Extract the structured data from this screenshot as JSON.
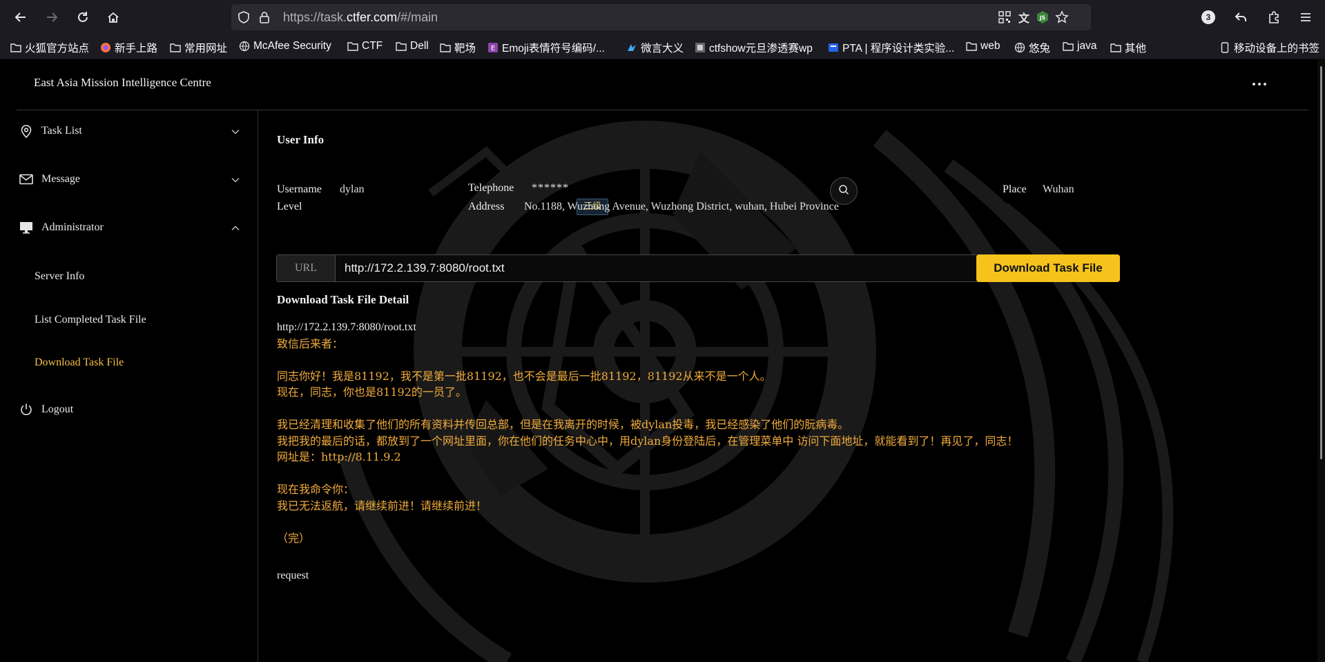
{
  "browser": {
    "url_prefix": "https://task.",
    "url_host": "ctfer.com",
    "url_rest": "/#/main",
    "notification_count": "3",
    "bookmarks": [
      {
        "icon": "folder-icon",
        "label": "火狐官方站点"
      },
      {
        "icon": "firefox-icon",
        "label": "新手上路"
      },
      {
        "icon": "folder-icon",
        "label": "常用网址"
      },
      {
        "icon": "globe-icon",
        "label": "McAfee Security"
      },
      {
        "icon": "folder-icon",
        "label": "CTF"
      },
      {
        "icon": "folder-icon",
        "label": "Dell"
      },
      {
        "icon": "folder-icon",
        "label": "靶场"
      },
      {
        "icon": "emoji-site-icon",
        "label": "Emoji表情符号编码/..."
      },
      {
        "icon": "weiyan-icon",
        "label": "微言大义"
      },
      {
        "icon": "ctfshow-icon",
        "label": "ctfshow元旦渗透赛wp"
      },
      {
        "icon": "pta-icon",
        "label": "PTA | 程序设计类实验..."
      },
      {
        "icon": "folder-icon",
        "label": "web"
      },
      {
        "icon": "globe-icon",
        "label": "悠兔"
      },
      {
        "icon": "folder-icon",
        "label": "java"
      },
      {
        "icon": "folder-icon",
        "label": "其他"
      },
      {
        "icon": "mobile-icon",
        "label": "移动设备上的书签"
      }
    ]
  },
  "app": {
    "title": "East Asia Mission Intelligence Centre"
  },
  "sidebar": {
    "items": [
      {
        "icon": "location-pin-icon",
        "label": "Task List",
        "expanded": false
      },
      {
        "icon": "mail-icon",
        "label": "Message",
        "expanded": false
      },
      {
        "icon": "monitor-icon",
        "label": "Administrator",
        "expanded": true
      }
    ],
    "sub_items": [
      {
        "label": "Server Info",
        "active": false
      },
      {
        "label": "List Completed Task File",
        "active": false
      },
      {
        "label": "Download Task File",
        "active": true
      }
    ],
    "logout": {
      "icon": "power-icon",
      "label": "Logout"
    }
  },
  "user_info": {
    "heading": "User Info",
    "username_label": "Username",
    "username": "dylan",
    "telephone_label": "Telephone",
    "telephone": "******",
    "place_label": "Place",
    "place": "Wuhan",
    "level_label": "Level",
    "level": "三级",
    "address_label": "Address",
    "address": "No.1188, Wuzhong Avenue, Wuzhong District, wuhan, Hubei Province"
  },
  "download": {
    "url_prefix": "URL",
    "url_value": "http://172.2.139.7:8080/root.txt",
    "button_label": "Download Task File"
  },
  "detail": {
    "heading": "Download Task File Detail",
    "url": "http://172.2.139.7:8080/root.txt",
    "lines": [
      "致信后来者：",
      "",
      "同志你好！我是81192，我不是第一批81192，也不会是最后一批81192，81192从来不是一个人。",
      "现在，同志，你也是81192的一员了。",
      "",
      "我已经清理和收集了他们的所有资料并传回总部，但是在我离开的时候，被dylan投毒，我已经感染了他们的朊病毒。",
      "我把我的最后的话，都放到了一个网址里面，你在他们的任务中心中，用dylan身份登陆后，在管理菜单中 访问下面地址，就能看到了！再见了，同志！",
      "网址是：http://8.11.9.2",
      "",
      "现在我命令你：",
      "我已无法返航，请继续前进！请继续前进！",
      "",
      "（完）"
    ],
    "request_label": "request"
  },
  "colors": {
    "accent": "#f5c31c",
    "letter_text": "#f2ac3c",
    "active_menu": "#f5c242",
    "background": "#000000"
  }
}
